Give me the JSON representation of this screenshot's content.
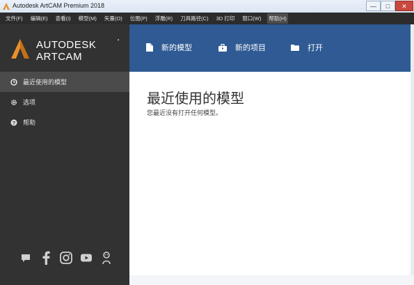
{
  "window": {
    "title": "Autodesk ArtCAM Premium 2018",
    "controls": {
      "minimize": "—",
      "maximize": "□",
      "close": "✕"
    }
  },
  "menubar": {
    "items": [
      {
        "label": "文件(F)"
      },
      {
        "label": "编辑(E)"
      },
      {
        "label": "查看(I)"
      },
      {
        "label": "模型(M)"
      },
      {
        "label": "矢量(O)"
      },
      {
        "label": "位图(P)"
      },
      {
        "label": "浮雕(R)"
      },
      {
        "label": "刀具路径(C)"
      },
      {
        "label": "3D 打印"
      },
      {
        "label": "窗口(W)"
      },
      {
        "label": "帮助(H)"
      }
    ]
  },
  "logo": {
    "line1": "AUTODESK",
    "line2": "ARTCAM",
    "mark": "▪"
  },
  "sidebar": {
    "items": [
      {
        "label": "最近使用的模型",
        "icon": "clock-icon"
      },
      {
        "label": "选项",
        "icon": "gear-icon"
      },
      {
        "label": "帮助",
        "icon": "help-icon"
      }
    ],
    "social": [
      "chat-icon",
      "facebook-icon",
      "instagram-icon",
      "youtube-icon",
      "forum-icon"
    ]
  },
  "header": {
    "new_model": "新的模型",
    "new_project": "新的项目",
    "open": "打开"
  },
  "main": {
    "title": "最近使用的模型",
    "subtitle": "您最近没有打开任何模型。"
  },
  "colors": {
    "sidebar": "#323232",
    "menubar": "#2c2c2c",
    "header": "#2f5a94",
    "accent": "#e8912d"
  }
}
